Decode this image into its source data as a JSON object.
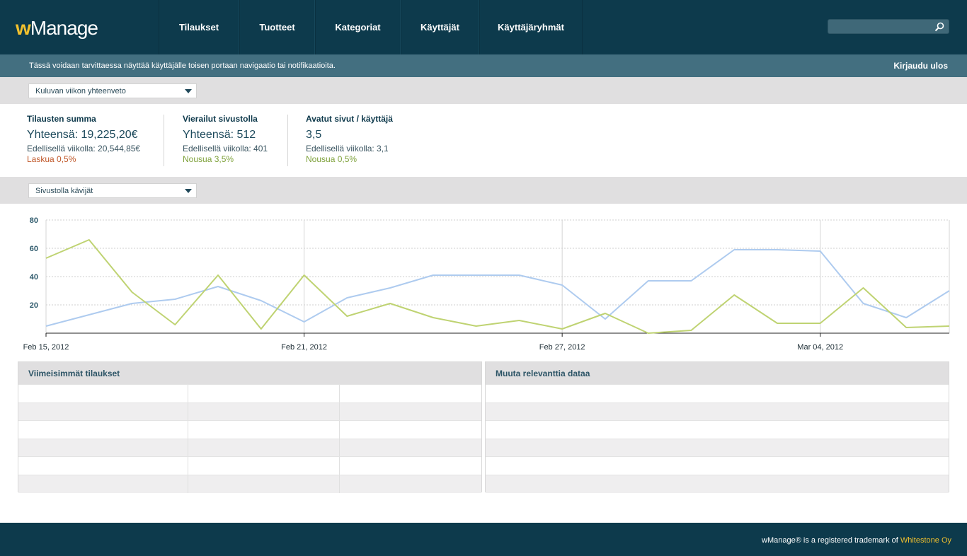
{
  "header": {
    "logo_w": "w",
    "logo_rest": "Manage",
    "nav": [
      {
        "label": "Tilaukset"
      },
      {
        "label": "Tuotteet"
      },
      {
        "label": "Kategoriat"
      },
      {
        "label": "Käyttäjät"
      },
      {
        "label": "Käyttäjäryhmät"
      }
    ],
    "search": {
      "value": "",
      "placeholder": "",
      "icon": "search-icon"
    }
  },
  "subbar": {
    "notice": "Tässä voidaan tarvittaessa näyttää käyttäjälle toisen portaan navigaatio tai notifikaatioita.",
    "logout": "Kirjaudu ulos"
  },
  "summary_select": {
    "value": "Kuluvan viikon yhteenveto"
  },
  "stats": [
    {
      "title": "Tilausten summa",
      "total": "Yhteensä: 19,225,20€",
      "prev": "Edellisellä viikolla: 20,544,85€",
      "change": "Laskua 0,5%",
      "trend": "down"
    },
    {
      "title": "Vierailut sivustolla",
      "total": "Yhteensä: 512",
      "prev": "Edellisellä viikolla: 401",
      "change": "Nousua 3,5%",
      "trend": "up"
    },
    {
      "title": "Avatut sivut / käyttäjä",
      "total": "3,5",
      "prev": "Edellisellä viikolla: 3,1",
      "change": "Nousua 0,5%",
      "trend": "up"
    }
  ],
  "chart_select": {
    "value": "Sivustolla kävijät"
  },
  "chart_data": {
    "type": "line",
    "x": [
      "Feb 15, 2012",
      "Feb 16, 2012",
      "Feb 17, 2012",
      "Feb 18, 2012",
      "Feb 19, 2012",
      "Feb 20, 2012",
      "Feb 21, 2012",
      "Feb 22, 2012",
      "Feb 23, 2012",
      "Feb 24, 2012",
      "Feb 25, 2012",
      "Feb 26, 2012",
      "Feb 27, 2012",
      "Feb 28, 2012",
      "Feb 29, 2012",
      "Mar 01, 2012",
      "Mar 02, 2012",
      "Mar 03, 2012",
      "Mar 04, 2012",
      "Mar 05, 2012",
      "Mar 06, 2012",
      "Mar 07, 2012"
    ],
    "xticks": [
      "Feb 15, 2012",
      "Feb 21, 2012",
      "Feb 27, 2012",
      "Mar 04, 2012"
    ],
    "yticks": [
      20,
      40,
      60,
      80
    ],
    "ylim": [
      0,
      80
    ],
    "grid": true,
    "series": [
      {
        "color": "#aecbef",
        "values": [
          5,
          13,
          21,
          24,
          33,
          23,
          8,
          25,
          32,
          41,
          41,
          41,
          34,
          10,
          37,
          37,
          59,
          59,
          58,
          21,
          11,
          30
        ]
      },
      {
        "color": "#bfd372",
        "values": [
          53,
          66,
          29,
          6,
          41,
          3,
          41,
          12,
          21,
          11,
          5,
          9,
          3,
          14,
          0,
          2,
          27,
          7,
          7,
          32,
          4,
          5
        ]
      }
    ]
  },
  "orders_panel": {
    "title": "Viimeisimmät tilaukset",
    "rows": 6,
    "cols": 3
  },
  "other_panel": {
    "title": "Muuta relevanttia dataa",
    "rows": 6,
    "cols": 1
  },
  "footer": {
    "text": "wManage® is a registered trademark of ",
    "company": "Whitestone Oy"
  }
}
